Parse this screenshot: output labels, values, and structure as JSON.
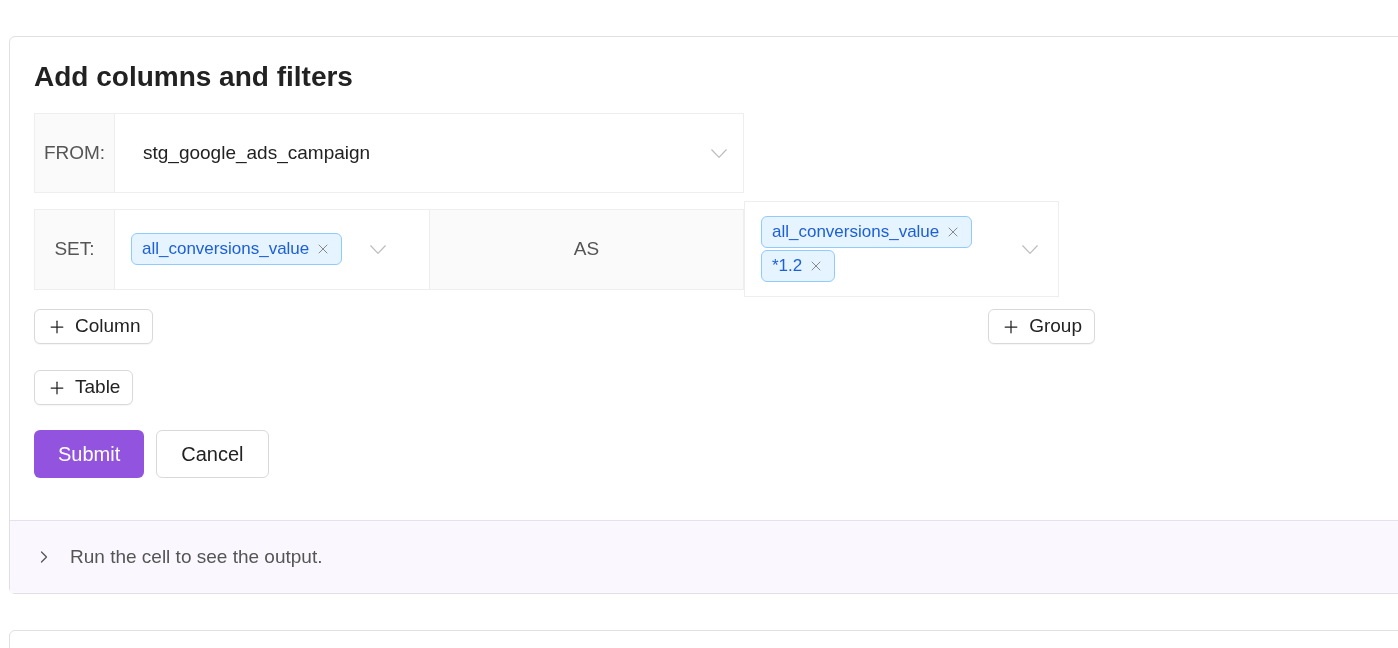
{
  "title": "Add columns and filters",
  "from": {
    "label": "FROM:",
    "value": "stg_google_ads_campaign"
  },
  "set": {
    "label": "SET:",
    "tags": [
      "all_conversions_value"
    ],
    "as_label": "AS",
    "as_tags": [
      "all_conversions_value",
      "*1.2"
    ]
  },
  "add_column": "Column",
  "add_group": "Group",
  "add_table": "Table",
  "buttons": {
    "submit": "Submit",
    "cancel": "Cancel"
  },
  "output": {
    "text": "Run the cell to see the output.",
    "expanded": false
  }
}
